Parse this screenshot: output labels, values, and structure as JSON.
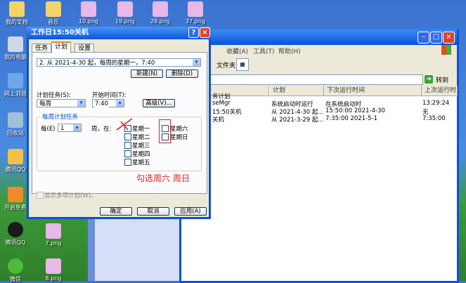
{
  "desktop": {
    "left_icons": [
      {
        "label": "我的文档",
        "color": "#f4d36b"
      },
      {
        "label": "我的电脑",
        "color": "#cfd8e8"
      },
      {
        "label": "网上邻居",
        "color": "#6fa6e6"
      },
      {
        "label": "回收站",
        "color": "#a0c0d8"
      },
      {
        "label": "腾讯QQ",
        "color": "#f5c04a"
      },
      {
        "label": "开启免费",
        "color": "#f08a2a"
      },
      {
        "label": "腾讯QQ",
        "color": "#1a1a1a"
      },
      {
        "label": "微信",
        "color": "#4dbb3a"
      }
    ],
    "top_icons": [
      {
        "label": "10.png"
      },
      {
        "label": "19.png"
      },
      {
        "label": "28.png"
      },
      {
        "label": "37.png"
      }
    ],
    "bottom_icons": [
      {
        "label": "7.png"
      },
      {
        "label": "8.png"
      }
    ],
    "folder_label": "音乐"
  },
  "explorer": {
    "menu": [
      "收藏(A)",
      "工具(T)",
      "帮助(H)"
    ],
    "folders_label": "文件夹",
    "go_label": "转到",
    "columns": [
      "计划",
      "下次运行时间",
      "上次运行时"
    ],
    "first_col_label": "务计划",
    "rows": [
      {
        "name": "seMgr",
        "plan": "系统启动时运行",
        "next": "在系统启动时",
        "last": "13:29:24"
      },
      {
        "name": "15:50关机",
        "plan": "从 2021-4-30 起...",
        "next": "15:50:00  2021-4-30",
        "last": "无"
      },
      {
        "name": "关机",
        "plan": "从 2021-3-29 起...",
        "next": "7:35:00  2021-5-1",
        "last": "7:35:00"
      }
    ]
  },
  "dialog": {
    "title": "工作日15:50关机",
    "help_btn": "?",
    "close_btn": "×",
    "tabs": [
      "任务",
      "计划",
      "设置"
    ],
    "schedule_select": "2. 从 2021-4-30 起，每周的星期一，7:40",
    "new_btn": "新建(N)",
    "delete_btn": "删除(D)",
    "plan_task_label": "计划任务(S):",
    "plan_task_value": "每周",
    "start_time_label": "开始时间(T):",
    "start_time_value": "7:40",
    "advanced_btn": "高级(V)...",
    "group_title": "每周计划任务",
    "every_label": "每(E)",
    "every_value": "1",
    "week_label": "周，在:",
    "days_left": [
      "星期一",
      "星期二",
      "星期三",
      "星期四",
      "星期五"
    ],
    "days_right": [
      "星期六",
      "星期日"
    ],
    "annotation": "勾选周六  周日",
    "multi_label": "显示多项计划(W)。",
    "ok_btn": "确定",
    "cancel_btn": "取消",
    "apply_btn": "应用(A)"
  },
  "colors": {
    "annotation": "#e0201a",
    "accent": "#0a52d6"
  }
}
